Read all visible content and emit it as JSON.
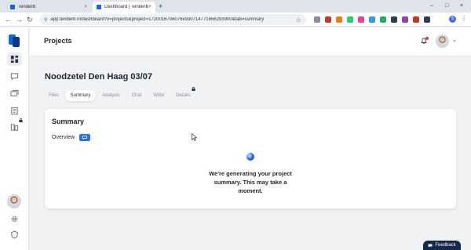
{
  "browser": {
    "tabs": [
      {
        "title": "TenderB",
        "close": "×"
      },
      {
        "title": "Dashboard | TenderB",
        "close": "×"
      }
    ],
    "new_tab": "+",
    "window_controls": {
      "minimize": "–",
      "maximize": "□",
      "close": "×"
    },
    "nav": {
      "back": "←",
      "forward": "→",
      "reload": "↻"
    },
    "url": "app.tenderb.nl/dashboard?v=projects&project=1720016706076x930714771856293900&tab=summary",
    "profile_initial": "S",
    "extension_colors": [
      "#8a8f98",
      "#c0392b",
      "#e67e22",
      "#2ecc71",
      "#e84393",
      "#3498db",
      "#27ae60",
      "#2c3e50",
      "#8e44ad",
      "#c0392b",
      "#2c3e50"
    ]
  },
  "header": {
    "title": "Projects",
    "chevron": "⌄"
  },
  "project": {
    "title": "Noodzetel Den Haag 03/07",
    "tabs": [
      {
        "label": "Files",
        "active": false
      },
      {
        "label": "Summary",
        "active": true
      },
      {
        "label": "Analysis",
        "active": false
      },
      {
        "label": "Chat",
        "active": false
      },
      {
        "label": "Write",
        "active": false
      },
      {
        "label": "Details",
        "active": false
      }
    ]
  },
  "summary": {
    "title": "Summary",
    "overview_label": "Overview",
    "message": "We're generating your project summary. This may take a moment."
  },
  "feedback_label": "Feedback",
  "colors": {
    "accent": "#2f6fdc",
    "brand": "#1565d8",
    "feedback_bg": "#152a4a"
  }
}
